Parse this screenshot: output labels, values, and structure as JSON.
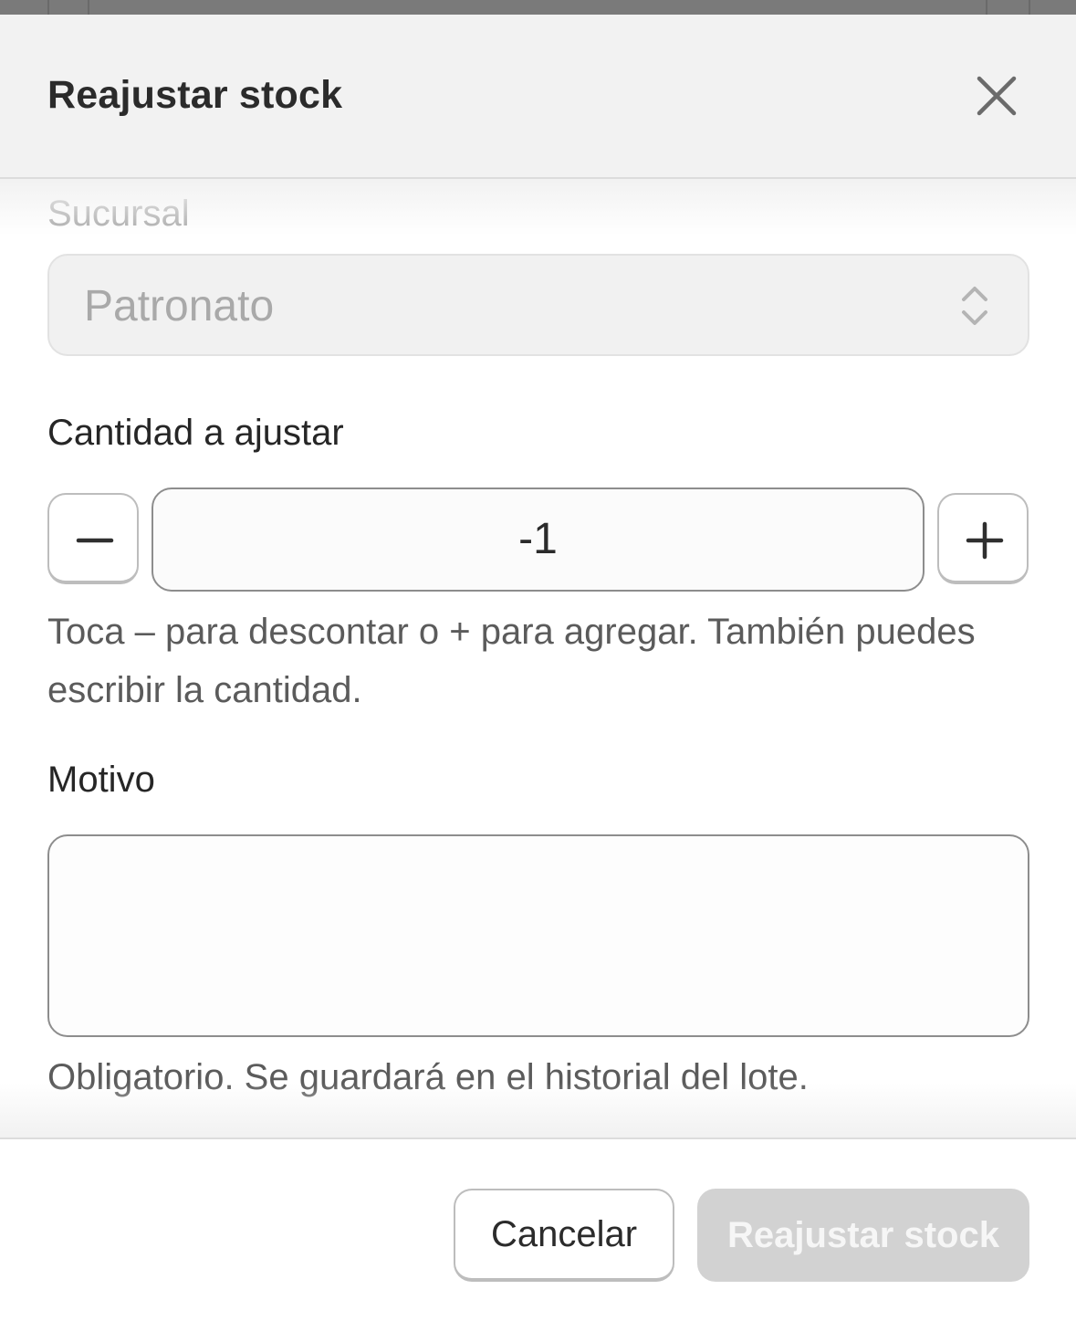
{
  "modal": {
    "title": "Reajustar stock",
    "close_icon": "close-icon"
  },
  "branch": {
    "label": "Sucursal",
    "selected": "Patronato",
    "icon": "chevron-up-down-icon"
  },
  "quantity": {
    "label": "Cantidad a ajustar",
    "value": "-1",
    "decrement_icon": "minus-icon",
    "increment_icon": "plus-icon",
    "help": "Toca – para descontar o + para agregar. También puedes escribir la cantidad."
  },
  "reason": {
    "label": "Motivo",
    "value": "",
    "help": "Obligatorio. Se guardará en el historial del lote."
  },
  "footer": {
    "cancel_label": "Cancelar",
    "submit_label": "Reajustar stock"
  },
  "colors": {
    "primary_disabled": "#d2d2d2",
    "text_dark": "#2b2b2b",
    "text_muted": "#a8a8a8"
  }
}
